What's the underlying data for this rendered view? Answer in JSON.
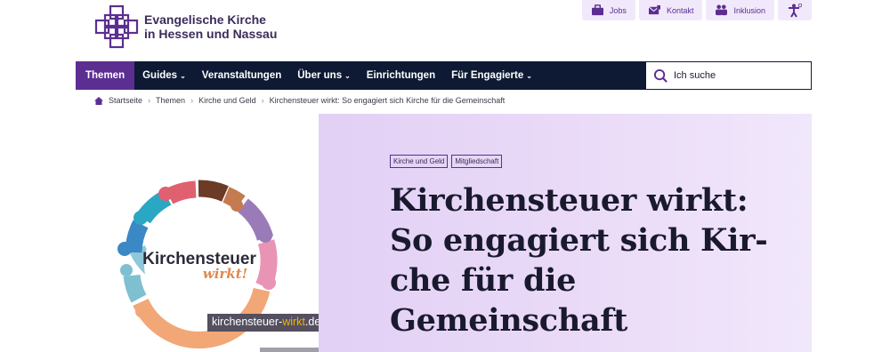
{
  "header": {
    "logo_line1": "Evangelische Kirche",
    "logo_line2": "in Hessen und Nassau",
    "service_nav": [
      {
        "label": "Jobs",
        "icon": "briefcase-icon"
      },
      {
        "label": "Kontakt",
        "icon": "mail-icon"
      },
      {
        "label": "Inklusion",
        "icon": "people-icon"
      }
    ],
    "accessibility_icon": "accessibility-icon"
  },
  "nav": {
    "items": [
      {
        "label": "Themen",
        "dropdown": false,
        "active": true
      },
      {
        "label": "Guides",
        "dropdown": true
      },
      {
        "label": "Veranstaltungen",
        "dropdown": false
      },
      {
        "label": "Über uns",
        "dropdown": true
      },
      {
        "label": "Einrichtungen",
        "dropdown": false
      },
      {
        "label": "Für Engagierte",
        "dropdown": true
      }
    ],
    "search_placeholder": "Ich suche"
  },
  "breadcrumb": [
    "Startseite",
    "Themen",
    "Kirche und Geld",
    "Kirchensteuer wirkt: So engagiert sich Kirche für die Gemeinschaft"
  ],
  "hero": {
    "image_title_line1": "Kirchensteuer",
    "image_title_line2": "wirkt!",
    "image_url_prefix": "kirchensteuer-",
    "image_url_accent": "wirkt",
    "image_url_suffix": ".de",
    "tags": [
      "Kirche und Geld",
      "Mitgliedschaft"
    ],
    "headline_lines": [
      "Kirchensteuer wirkt:",
      "So engagiert sich Kir-",
      "che für die",
      "Gemeinschaft"
    ]
  },
  "colors": {
    "brand_purple": "#5c2e91",
    "nav_dark": "#0e1a33",
    "hero_bg": "#e6d5f7"
  }
}
